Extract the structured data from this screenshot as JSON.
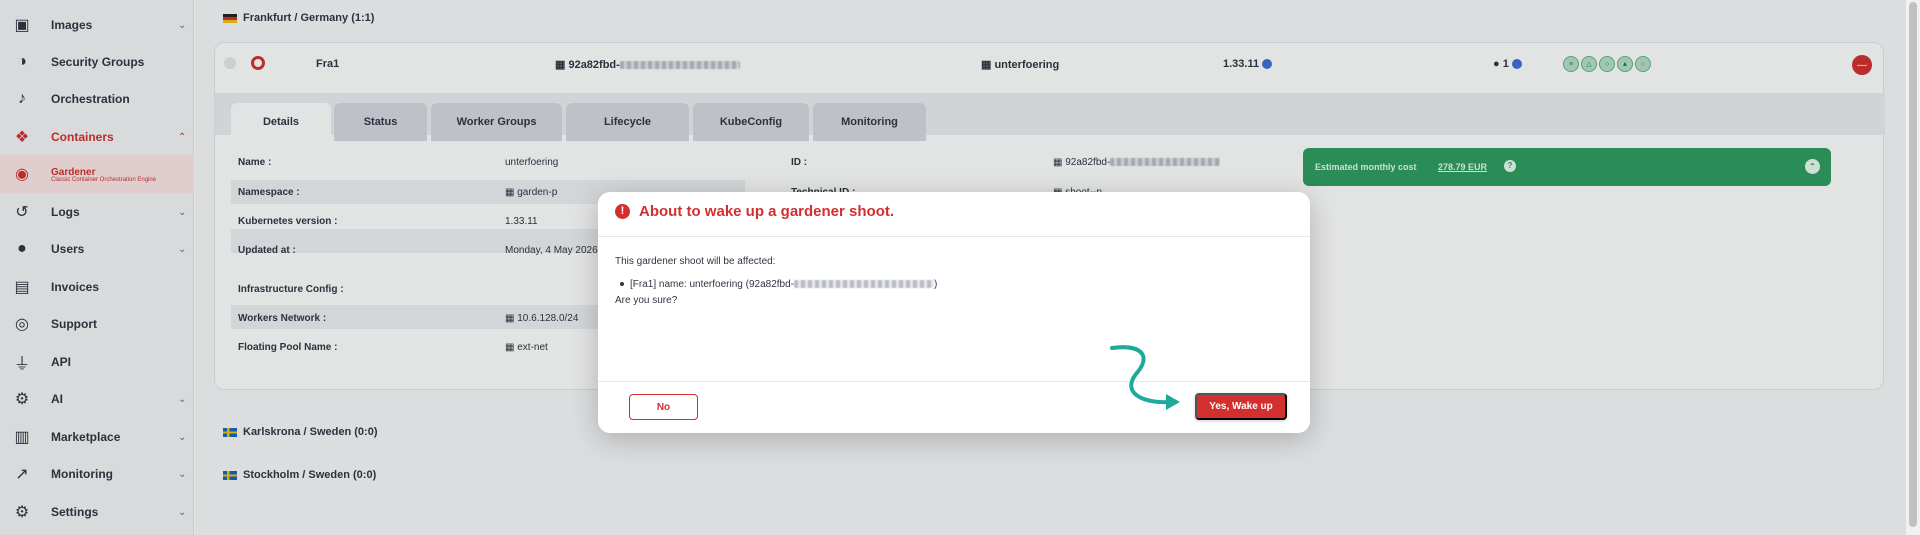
{
  "colors": {
    "brand_red": "#d32f2f",
    "cost_green": "#2e9d60",
    "arrow_teal": "#1fa99a"
  },
  "sidebar": {
    "items": [
      {
        "label": "Images",
        "icon": "camera-icon",
        "glyph": "▣",
        "chevron": "⌄"
      },
      {
        "label": "Security Groups",
        "icon": "shield-icon",
        "glyph": "◑",
        "chevron": ""
      },
      {
        "label": "Orchestration",
        "icon": "music-note-icon",
        "glyph": "♪",
        "chevron": ""
      },
      {
        "label": "Containers",
        "icon": "box-icon",
        "glyph": "❖",
        "chevron": "⌃"
      },
      {
        "label": "Gardener",
        "sub": "Classic Container Orchestration Engine",
        "icon": "gardener-icon",
        "glyph": "◉",
        "chevron": ""
      },
      {
        "label": "Logs",
        "icon": "history-icon",
        "glyph": "↺",
        "chevron": "⌄"
      },
      {
        "label": "Users",
        "icon": "user-icon",
        "glyph": "●",
        "chevron": "⌄"
      },
      {
        "label": "Invoices",
        "icon": "invoice-icon",
        "glyph": "▤",
        "chevron": ""
      },
      {
        "label": "Support",
        "icon": "lifebuoy-icon",
        "glyph": "◎",
        "chevron": ""
      },
      {
        "label": "API",
        "icon": "plug-icon",
        "glyph": "⏚",
        "chevron": ""
      },
      {
        "label": "AI",
        "icon": "brain-icon",
        "glyph": "⚙",
        "chevron": "⌄"
      },
      {
        "label": "Marketplace",
        "icon": "cart-icon",
        "glyph": "▥",
        "chevron": "⌄"
      },
      {
        "label": "Monitoring",
        "icon": "chart-line-icon",
        "glyph": "↗",
        "chevron": "⌄"
      },
      {
        "label": "Settings",
        "icon": "gear-icon",
        "glyph": "⚙",
        "chevron": "⌄"
      }
    ]
  },
  "main": {
    "regions": [
      {
        "label": "Frankfurt / Germany (1:1)",
        "chevron": "⌄"
      },
      {
        "label": "Karlskrona / Sweden (0:0)",
        "chevron": "⌄"
      },
      {
        "label": "Stockholm / Sweden (0:0)",
        "chevron": "⌄"
      }
    ],
    "cluster": {
      "name": "Fra1",
      "id_short": "92a82fbd-",
      "project": "unterfoering",
      "version": "1.33.11",
      "workers": "1",
      "addons": [
        "≡",
        "△",
        "○",
        "▲",
        "○"
      ]
    },
    "tabs": [
      "Details",
      "Status",
      "Worker Groups",
      "Lifecycle",
      "KubeConfig",
      "Monitoring"
    ],
    "details": {
      "rows": [
        {
          "label": "Name :",
          "value": "unterfoering"
        },
        {
          "label": "Namespace :",
          "value": "garden-p"
        },
        {
          "label": "Kubernetes version :",
          "value": "1.33.11"
        },
        {
          "label": "Updated at :",
          "value": "Monday, 4 May 2026"
        }
      ],
      "infra_heading": "Infrastructure Config :",
      "infra_rows": [
        {
          "label": "Workers Network :",
          "value": "10.6.128.0/24"
        },
        {
          "label": "Floating Pool Name :",
          "value": "ext-net"
        }
      ],
      "right_rows": [
        {
          "label": "ID :",
          "value": "92a82fbd-"
        },
        {
          "label": "Technical ID :",
          "value": "shoot--p"
        }
      ]
    },
    "cost": {
      "label": "Estimated monthly cost",
      "value": "278.79 EUR"
    }
  },
  "modal": {
    "title": "About to wake up a gardener shoot.",
    "intro": "This gardener shoot will be affected:",
    "item_prefix": "[Fra1] name: unterfoering (92a82fbd-",
    "item_suffix": ")",
    "question": "Are you sure?",
    "no_label": "No",
    "yes_label": "Yes, Wake up"
  }
}
